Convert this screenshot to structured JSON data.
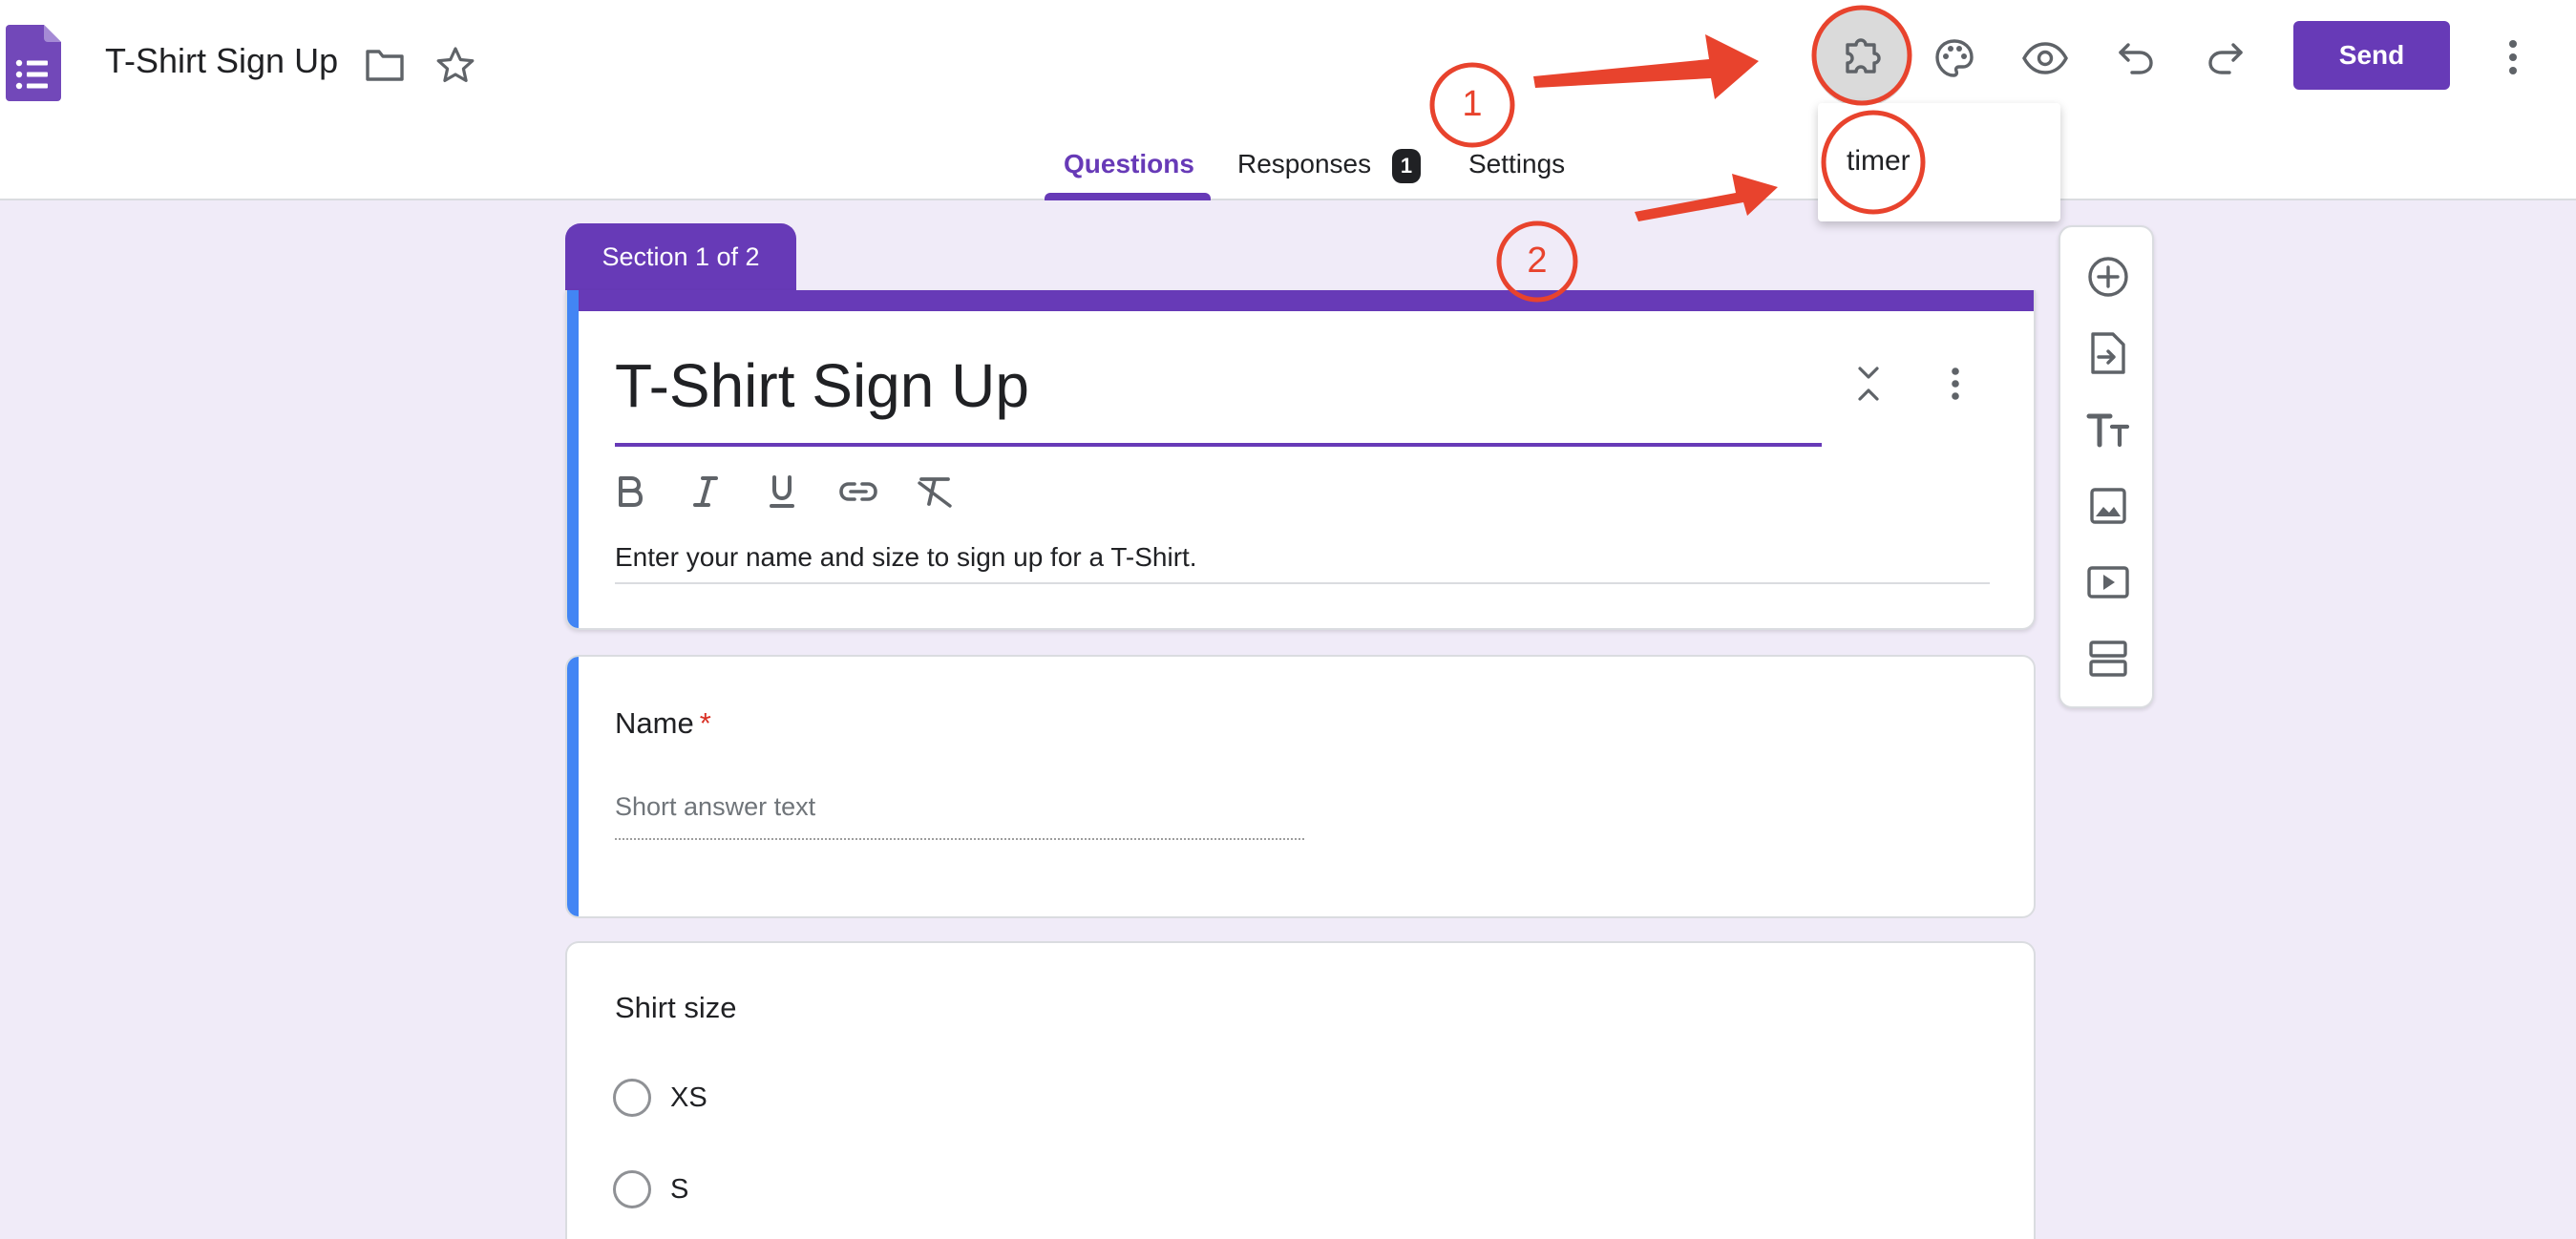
{
  "header": {
    "doc_title": "T-Shirt Sign Up",
    "send_label": "Send",
    "icons": [
      "forms-logo-icon",
      "folder-icon",
      "star-icon",
      "addons-puzzle-icon",
      "palette-icon",
      "eye-icon",
      "undo-icon",
      "redo-icon",
      "more-vert-icon"
    ],
    "brand_color": "#673ab7"
  },
  "tabs": [
    {
      "label": "Questions",
      "active": true
    },
    {
      "label": "Responses",
      "badge": "1"
    },
    {
      "label": "Settings"
    }
  ],
  "addon_menu": {
    "items": [
      {
        "label": "timer"
      }
    ]
  },
  "form": {
    "section_label": "Section 1 of 2",
    "title": "T-Shirt Sign Up",
    "description": "Enter your name and size to sign up for a T-Shirt.",
    "format_tools": [
      "bold-icon",
      "italic-icon",
      "underline-icon",
      "link-icon",
      "clear-format-icon"
    ],
    "questions": [
      {
        "label": "Name",
        "required": "*",
        "placeholder": "Short answer text"
      },
      {
        "label": "Shirt size",
        "options": [
          "XS",
          "S"
        ]
      }
    ]
  },
  "toolbar": {
    "tools": [
      "add-question-icon",
      "import-questions-icon",
      "add-title-icon",
      "add-image-icon",
      "add-video-icon",
      "add-section-icon"
    ]
  },
  "annotations": {
    "steps": [
      "1",
      "2"
    ],
    "color": "#e8432d"
  }
}
